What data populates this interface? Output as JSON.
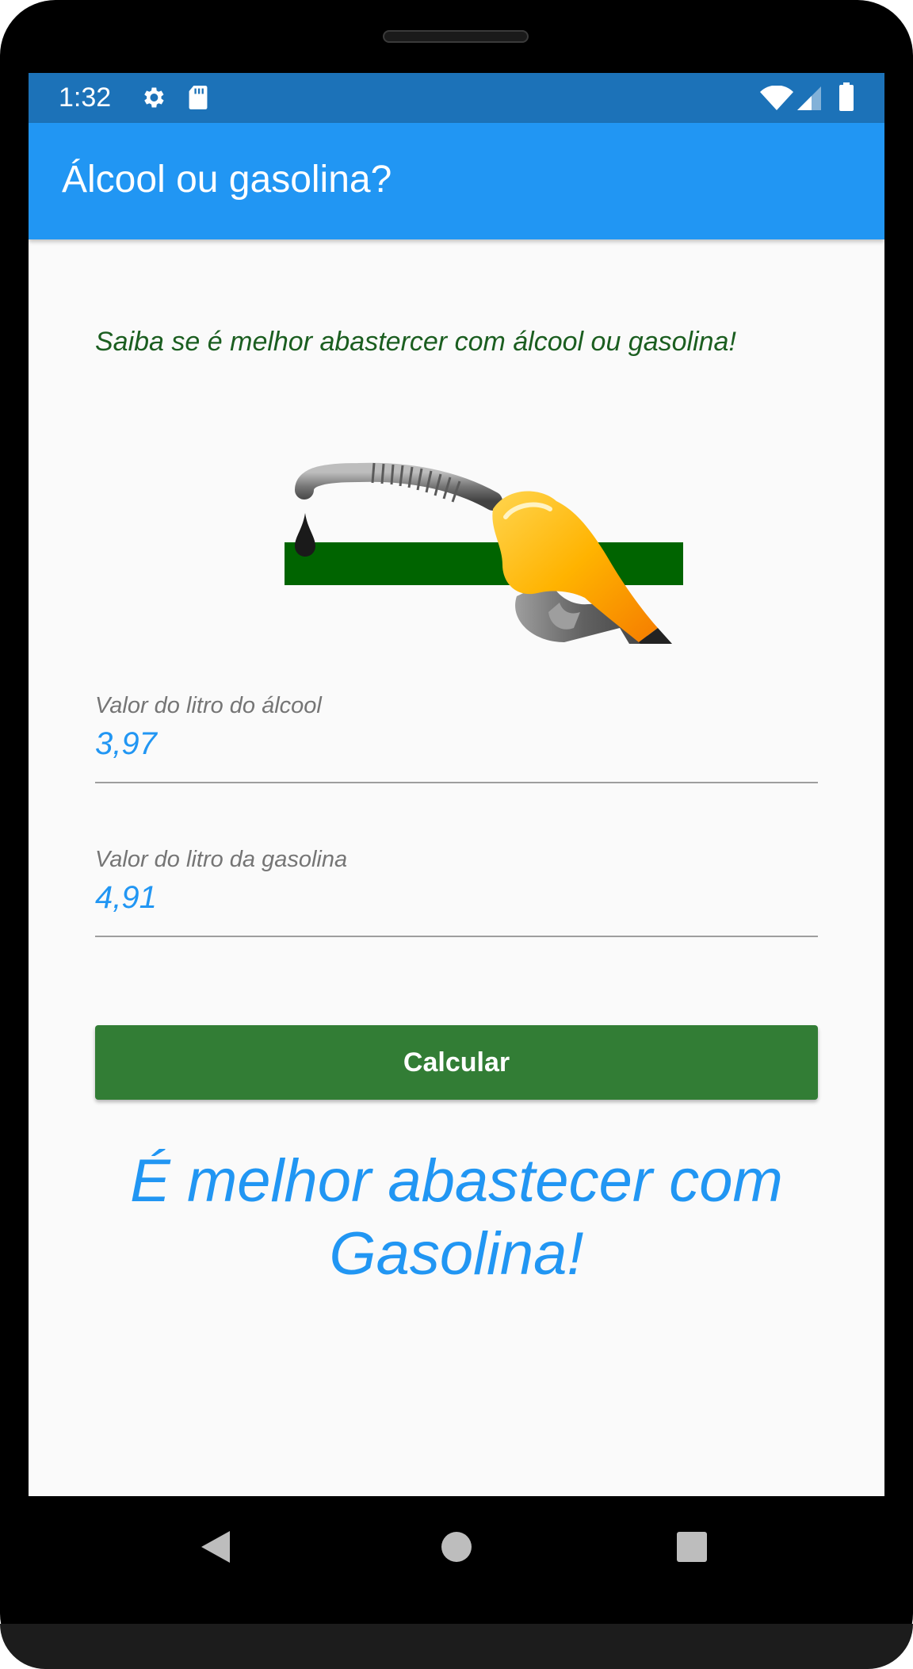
{
  "status_bar": {
    "time": "1:32",
    "icons": [
      "gear-icon",
      "sd-card-icon",
      "wifi-icon",
      "cell-signal-icon",
      "battery-icon"
    ]
  },
  "app_bar": {
    "title": "Álcool ou gasolina?"
  },
  "main": {
    "intro_text": "Saiba se é melhor abastercer com álcool ou gasolina!",
    "logo": "fuel-pump-nozzle-icon",
    "alcohol_field": {
      "label": "Valor do litro do álcool",
      "value": "3,97"
    },
    "gasoline_field": {
      "label": "Valor do litro da gasolina",
      "value": "4,91"
    },
    "calculate_button": "Calcular",
    "result_line1": "É melhor abastecer com",
    "result_line2": "Gasolina!"
  },
  "nav_bar": {
    "icons": [
      "back-icon",
      "home-icon",
      "recent-apps-icon"
    ]
  },
  "colors": {
    "status_bar": "#1c72b8",
    "app_bar": "#2196f3",
    "intro_text": "#1b5e20",
    "button": "#327d35",
    "accent": "#2196f3",
    "logo_bar": "#006400",
    "nozzle": "#ffb300"
  }
}
